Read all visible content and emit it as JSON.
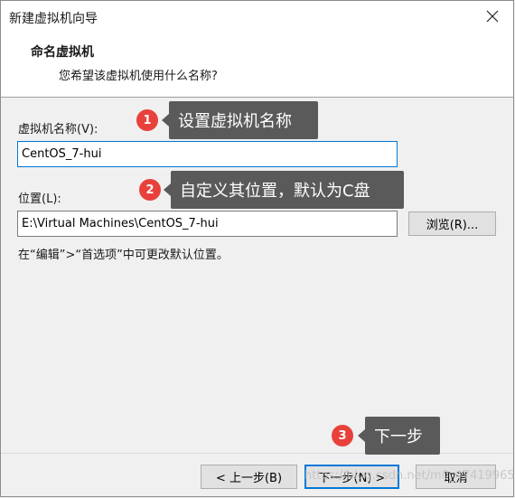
{
  "window": {
    "title": "新建虚拟机向导"
  },
  "header": {
    "title": "命名虚拟机",
    "subtitle": "您希望该虚拟机使用什么名称?"
  },
  "form": {
    "name_label": "虚拟机名称(V):",
    "name_value": "CentOS_7-hui",
    "location_label": "位置(L):",
    "location_value": "E:\\Virtual Machines\\CentOS_7-hui",
    "browse_label": "浏览(R)...",
    "hint": "在“编辑”>“首选项”中可更改默认位置。"
  },
  "footer": {
    "back_label": "< 上一步(B)",
    "next_label": "下一步(N) >",
    "cancel_label": "取消"
  },
  "annotations": [
    {
      "number": "1",
      "text": "设置虚拟机名称"
    },
    {
      "number": "2",
      "text": "自定义其位置，默认为C盘"
    },
    {
      "number": "3",
      "text": "下一步"
    }
  ],
  "watermark": "https://blog.csdn.net/m0_47419965",
  "icons": {
    "close": "close-icon"
  },
  "colors": {
    "badge": "#e8413b",
    "callout": "#5a5a5a",
    "focus": "#0078d7"
  }
}
